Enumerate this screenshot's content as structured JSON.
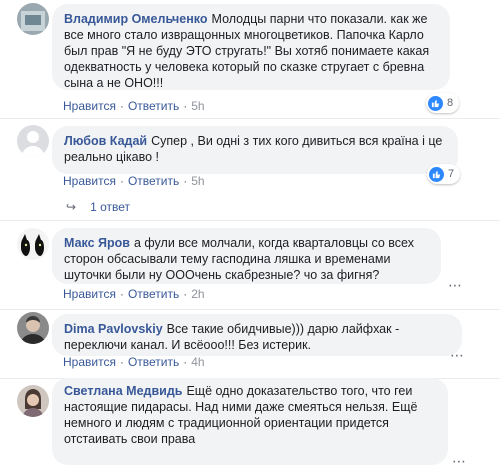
{
  "actions": {
    "like": "Нравится",
    "reply": "Ответить",
    "sep": "·"
  },
  "comments": [
    {
      "author": "Владимир Омельченко",
      "text": "Молодцы парни что показали. как же все много стало извращонных многоцветиков. Папочка Карло был прав \"Я не буду ЭТО стругать!\" Вы хотяб понимаете какая одекватность у человека который по сказке стругает с бревна сына а не ОНО!!!",
      "time": "5h",
      "likes": "8"
    },
    {
      "author": "Любов Кадай",
      "text": "Супер , Ви одні з тих кого дивиться вся країна і це реально цікаво !",
      "time": "5h",
      "likes": "7",
      "replies": "1 ответ"
    },
    {
      "author": "Макс Яров",
      "text": "а фули все молчали, когда кварталовцы со всех сторон обсасывали тему гасподина ляшка и временами шуточки были ну ОООчень скабрезные? чо за фигня?",
      "time": "2h",
      "likes": ""
    },
    {
      "author": "Dima Pavlovskiy",
      "text": "Все такие обидчивые))) дарю лайфхак - переключи канал. И всёооо!!! Без истерик.",
      "time": "4h",
      "likes": ""
    },
    {
      "author": "Светлана Медвидь",
      "text": "Ещё одно доказательство того, что геи настоящие пидарасы. Над ними даже смеяться нельзя. Ещё немного и людям с традиционной ориентации придется отстаивать свои права",
      "time": "",
      "likes": ""
    }
  ],
  "colors": {
    "link": "#385898",
    "bubble": "#f2f3f5",
    "like_blue": "#2d88ff"
  }
}
